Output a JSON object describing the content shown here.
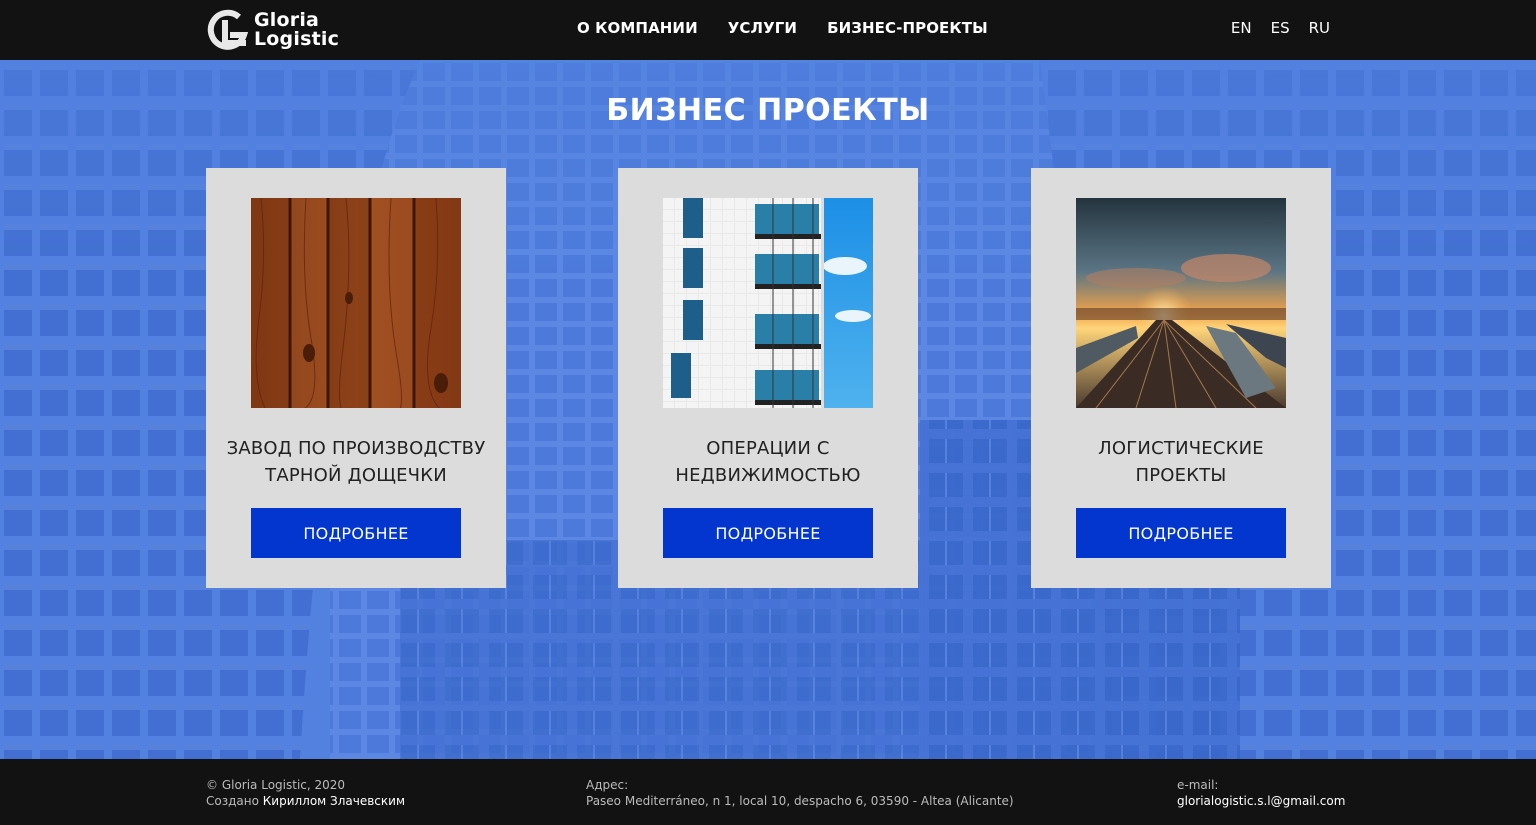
{
  "header": {
    "logo": {
      "line1": "Gloria",
      "line2": "Logistic",
      "icon": "gl-monogram-icon"
    },
    "nav": [
      {
        "label": "О КОМПАНИИ"
      },
      {
        "label": "УСЛУГИ"
      },
      {
        "label": "БИЗНЕС-ПРОЕКТЫ"
      }
    ],
    "languages": [
      "EN",
      "ES",
      "RU"
    ]
  },
  "main": {
    "title": "БИЗНЕС ПРОЕКТЫ",
    "background": "blue-tinted-office-buildings-photo",
    "cards": [
      {
        "title": "ЗАВОД ПО ПРОИЗВОДСТВУ ТАРНОЙ ДОЩЕЧКИ",
        "image": "wooden-planks-photo",
        "button": "ПОДРОБНЕЕ"
      },
      {
        "title": "ОПЕРАЦИИ С НЕДВИЖИМОСТЬЮ",
        "image": "apartment-building-balconies-photo",
        "button": "ПОДРОБНЕЕ"
      },
      {
        "title": "ЛОГИСТИЧЕСКИЕ ПРОЕКТЫ",
        "image": "railway-yard-sunset-photo",
        "button": "ПОДРОБНЕЕ"
      }
    ]
  },
  "footer": {
    "copyright": "© Gloria Logistic, 2020",
    "created_prefix": "Создано",
    "created_by": "Кириллом Злачевским",
    "address_label": "Адрес:",
    "address": "Paseo Mediterráneo, n 1, local 10, despacho 6, 03590 - Altea (Alicante)",
    "email_label": "e-mail:",
    "email": "glorialogistic.s.l@gmail.com"
  },
  "colors": {
    "header_bg": "#121212",
    "hero_blue": "#4a79da",
    "card_bg": "#dcdcdc",
    "button_blue": "#0336cf"
  }
}
